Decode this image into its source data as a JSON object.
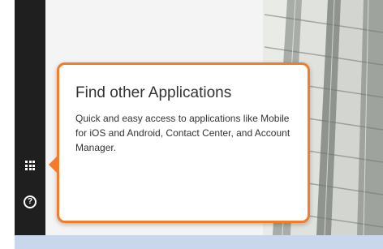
{
  "sidebar": {
    "items": [
      {
        "icon": "app-grid-icon"
      },
      {
        "icon": "help-icon",
        "glyph": "?"
      }
    ]
  },
  "tooltip": {
    "title": "Find other Applications",
    "body": "Quick and easy access to applications like Mobile for iOS and Android, Contact Center, and Account Manager.",
    "action_label": ""
  },
  "colors": {
    "accent": "#f47b2a",
    "sidebar": "#1f1f1f",
    "panel": "#f4f4f4",
    "bottom_band": "#c9d7ec"
  }
}
